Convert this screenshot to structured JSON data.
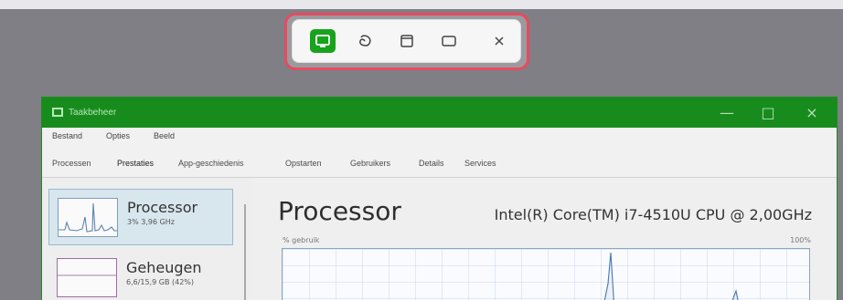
{
  "snipping_toolbar": {
    "buttons": [
      {
        "name": "rectangle-mode"
      },
      {
        "name": "freeform-mode"
      },
      {
        "name": "window-mode"
      },
      {
        "name": "fullscreen-mode"
      },
      {
        "name": "close"
      }
    ],
    "colors": {
      "highlight": "#e74b5f",
      "active": "#18a31d"
    }
  },
  "task_manager": {
    "title": "Taakbeheer",
    "menu": [
      "Bestand",
      "Opties",
      "Beeld"
    ],
    "tabs": [
      "Processen",
      "Prestaties",
      "App-geschiedenis",
      "Opstarten",
      "Gebruikers",
      "Details",
      "Services"
    ],
    "selected_tab": "Prestaties",
    "left_items": [
      {
        "name": "Processor",
        "detail": "3% 3,96 GHz"
      },
      {
        "name": "Geheugen",
        "detail": "6,6/15,9 GB (42%)"
      }
    ],
    "main": {
      "title": "Processor",
      "cpu": "Intel(R) Core(TM) i7-4510U CPU @ 2,00GHz",
      "graph_left_label": "% gebruik",
      "graph_right_label": "100%"
    }
  }
}
